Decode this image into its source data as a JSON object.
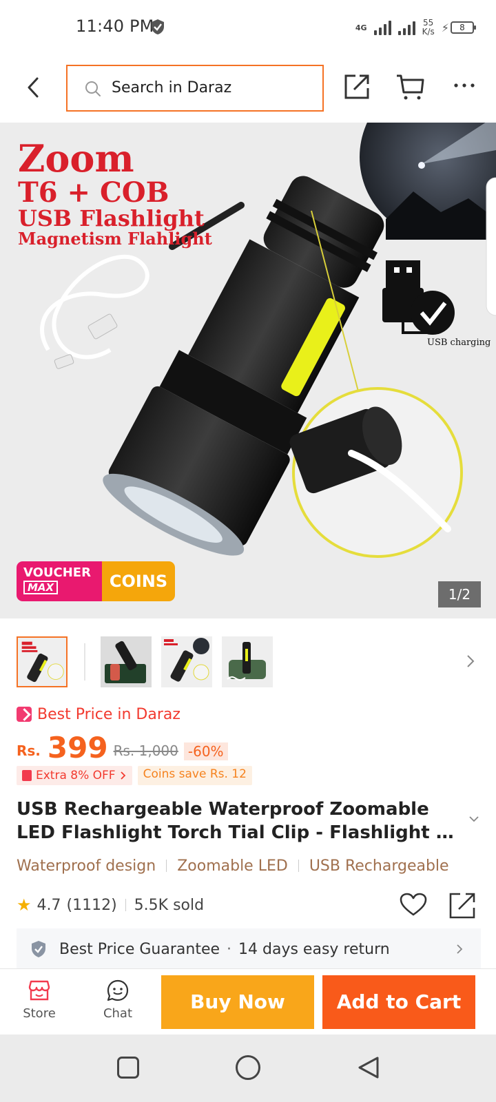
{
  "status_bar": {
    "time": "11:40 PM",
    "network_type": "4G",
    "speed_value": "55",
    "speed_unit": "K/s",
    "battery_level": "8"
  },
  "top_nav": {
    "search_placeholder": "Search in Daraz",
    "icons": [
      "back-icon",
      "search-icon",
      "share-icon",
      "cart-icon",
      "more-icon"
    ]
  },
  "hero": {
    "title_line1": "Zoom",
    "title_line2": "T6 + COB",
    "title_line3": "USB Flashlight",
    "title_line4": "Magnetism Flahlight",
    "usb_label": "USB charging",
    "voucher_label": "VOUCHER",
    "voucher_max": "MAX",
    "coins_label": "COINS",
    "page_indicator": "1/2"
  },
  "thumbnails": {
    "count": 4,
    "active_index": 0
  },
  "price": {
    "best_price_label": "Best Price in Daraz",
    "currency": "Rs.",
    "current": "399",
    "original": "Rs. 1,000",
    "discount": "-60%",
    "promo_extra": "Extra 8% OFF",
    "promo_coins": "Coins save Rs. 12"
  },
  "product": {
    "title_line1": "USB Rechargeable Waterproof Zoomable",
    "title_line2": "LED Flashlight Torch Tial Clip - Flashlight Rec...",
    "features": [
      "Waterproof design",
      "Zoomable LED",
      "USB Rechargeable"
    ],
    "rating": "4.7",
    "reviews": "(1112)",
    "sold": "5.5K sold"
  },
  "guarantee": {
    "best_price": "Best Price Guarantee",
    "separator": "·",
    "returns": "14 days easy return"
  },
  "action_bar": {
    "store_label": "Store",
    "chat_label": "Chat",
    "buy_now_label": "Buy Now",
    "add_to_cart_label": "Add to Cart"
  },
  "colors": {
    "brand_orange": "#f57224",
    "buy_now": "#f9a61a",
    "add_to_cart": "#f95a1a",
    "price": "#f5621e",
    "feature_text": "#a0704e"
  }
}
